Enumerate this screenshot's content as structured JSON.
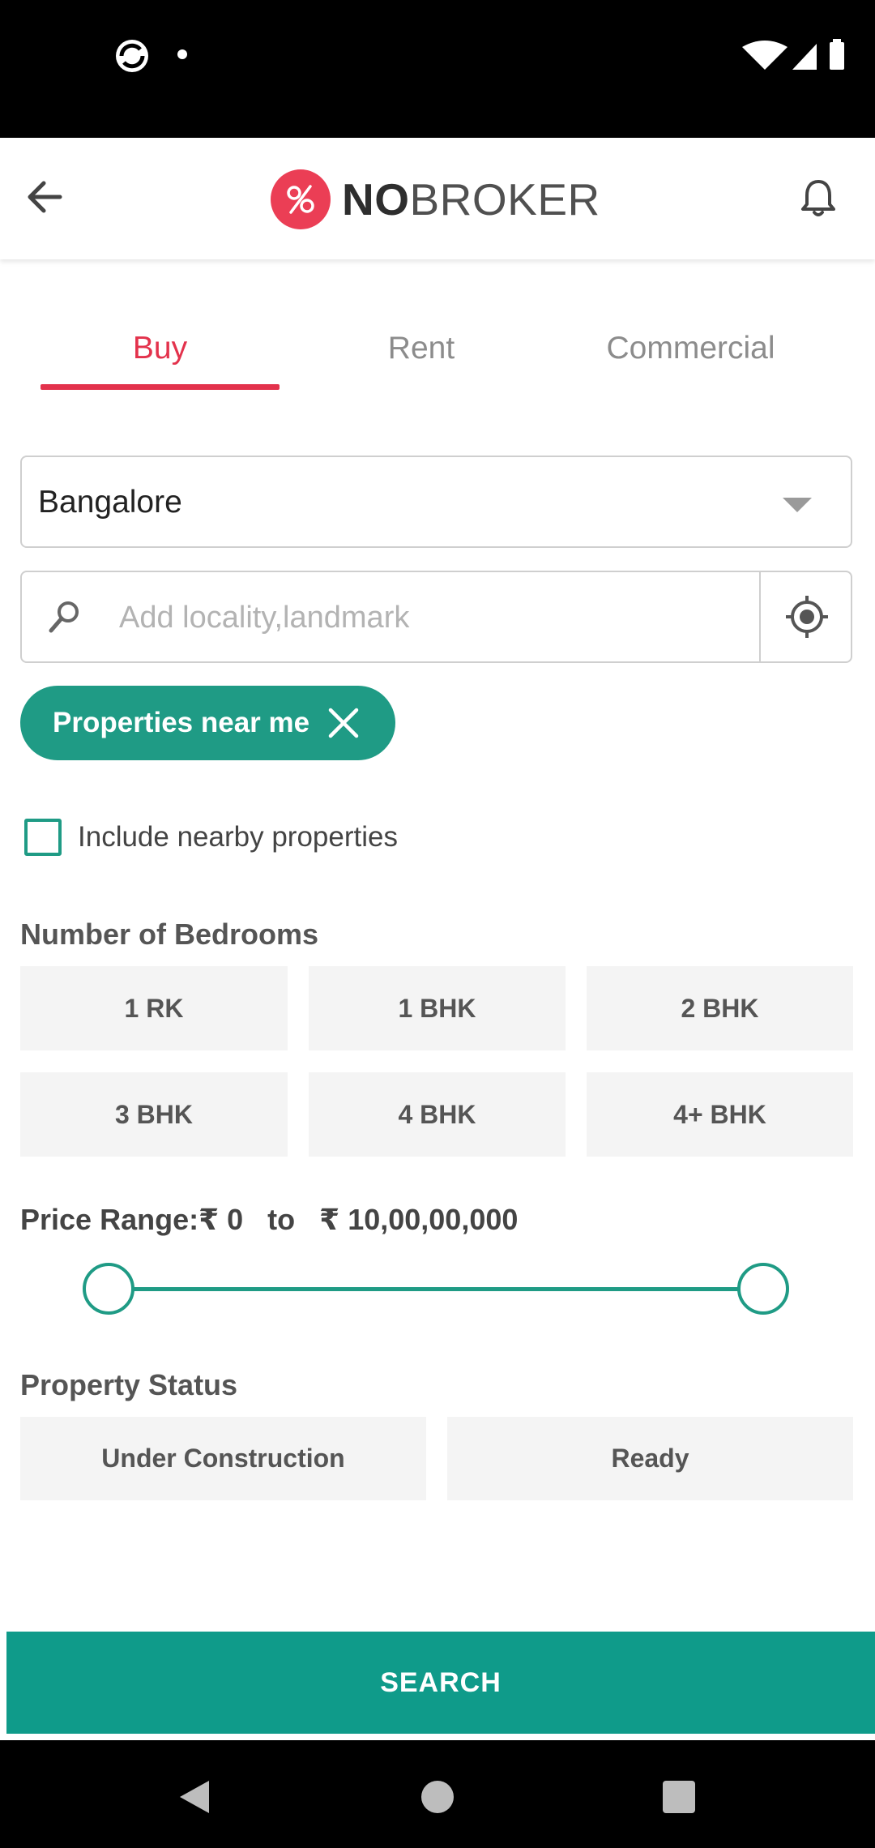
{
  "app": {
    "logo_bold": "NO",
    "logo_light": "BROKER"
  },
  "tabs": [
    {
      "label": "Buy",
      "active": true
    },
    {
      "label": "Rent",
      "active": false
    },
    {
      "label": "Commercial",
      "active": false
    }
  ],
  "city": {
    "value": "Bangalore"
  },
  "locality": {
    "placeholder": "Add locality,landmark"
  },
  "chip": {
    "label": "Properties near me"
  },
  "nearby": {
    "label": "Include nearby properties",
    "checked": false
  },
  "bedrooms": {
    "title": "Number of Bedrooms",
    "options": [
      "1 RK",
      "1 BHK",
      "2 BHK",
      "3 BHK",
      "4 BHK",
      "4+ BHK"
    ]
  },
  "price": {
    "label": "Price Range:₹ 0   to   ₹ 10,00,00,000",
    "min": 0,
    "max": 100000000
  },
  "status": {
    "title": "Property Status",
    "options": [
      "Under Construction",
      "Ready"
    ]
  },
  "search_button": {
    "label": "SEARCH"
  },
  "colors": {
    "accent_red": "#e3324c",
    "teal": "#1f9b85"
  }
}
